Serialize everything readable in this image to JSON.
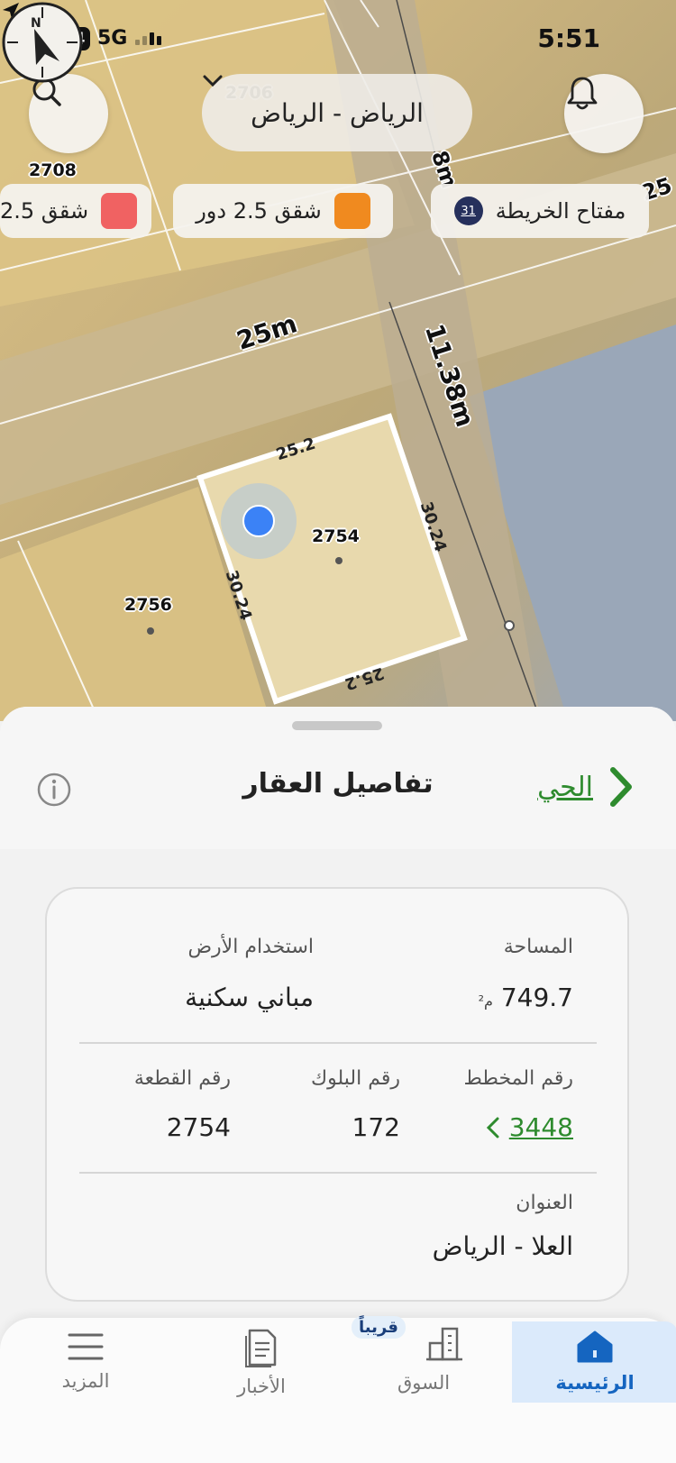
{
  "status_bar": {
    "battery": "74",
    "network": "5G",
    "time": "5:51"
  },
  "map": {
    "city_selector": "الرياض - الرياض",
    "chips": {
      "map_key_label": "مفتاح الخريطة",
      "map_key_badge": "31",
      "orange_label": "شقق 2.5 دور",
      "red_label": "شقق 2.5"
    },
    "colors": {
      "orange": "#f08a1f",
      "red": "#f06262",
      "selected_parcel_outline": "#ffffff",
      "location_dot": "#3b82f6"
    },
    "parcel_labels": {
      "top_left": "2708",
      "top_center": "2706",
      "selected": "2754",
      "left": "2756"
    },
    "road_labels": {
      "road_25m": "25m",
      "road_1138": "11.38m",
      "road_top": "8m",
      "road_right": "25"
    },
    "dimensions": {
      "top": "25.2",
      "right": "30.24",
      "left": "30.24",
      "bottom": "25.2"
    }
  },
  "sheet": {
    "title": "تفاصيل العقار",
    "district_link": "الحي",
    "area_label": "المساحة",
    "area_value": "749.7",
    "area_unit": "م²",
    "land_use_label": "استخدام الأرض",
    "land_use_value": "مباني سكنية",
    "plan_label": "رقم المخطط",
    "plan_value": "3448",
    "block_label": "رقم البلوك",
    "block_value": "172",
    "plot_label": "رقم القطعة",
    "plot_value": "2754",
    "address_label": "العنوان",
    "address_value": "العلا - الرياض"
  },
  "tab_bar": {
    "home": "الرئيسية",
    "market": "السوق",
    "market_badge": "قريباً",
    "news": "الأخبار",
    "more": "المزيد",
    "active_color": "#1565c0"
  }
}
